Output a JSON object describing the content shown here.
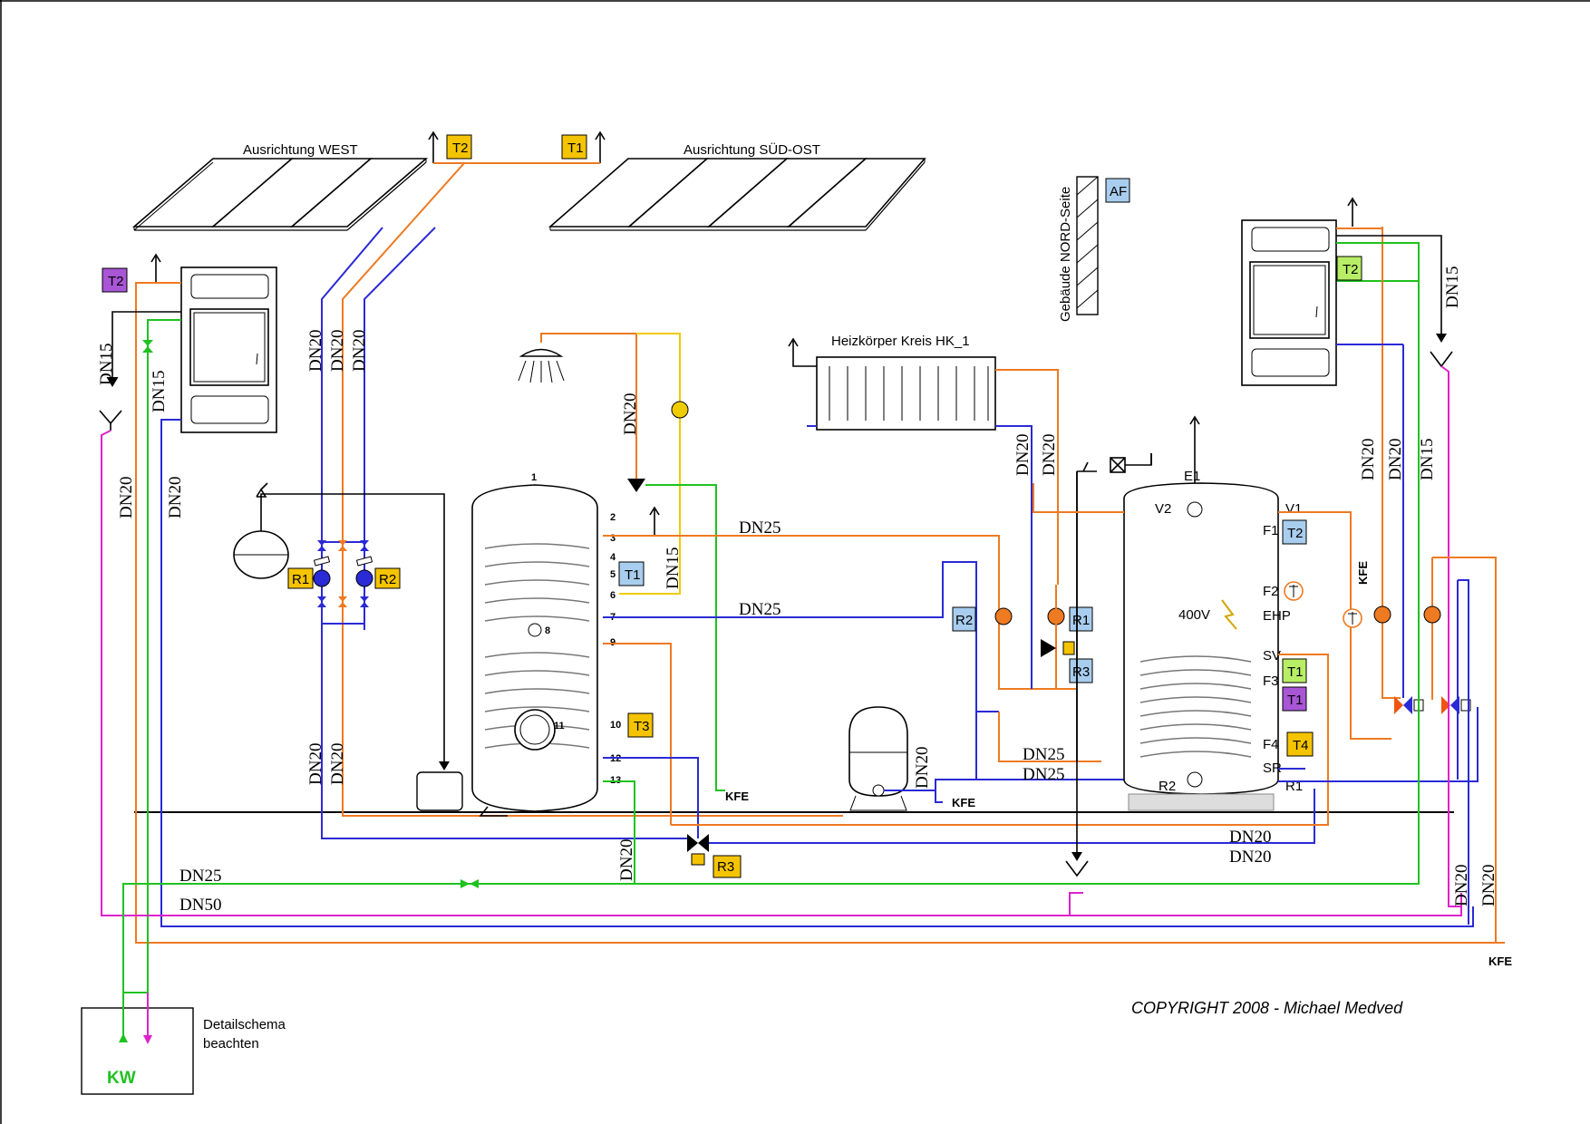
{
  "colors": {
    "flow": "#ee7a22",
    "return": "#2a2ad6",
    "cold_water": "#1fc21f",
    "drain": "#dd22cc",
    "hot_water_circ": "#eecc00",
    "tag_orange": "#f5c400",
    "tag_blue": "#a8cdee",
    "tag_purple": "#a855d6",
    "tag_green": "#b8ee66"
  },
  "titles": {
    "collector_west": "Ausrichtung WEST",
    "collector_southeast": "Ausrichtung SÜD-OST",
    "radiator": "Heizkörper Kreis HK_1",
    "building_north": "Gebäude NORD-Seite",
    "detail_note_line1": "Detailschema",
    "detail_note_line2": "beachten",
    "cold_water": "KW",
    "voltage": "400V",
    "copyright": "COPYRIGHT 2008 - Michael Medved"
  },
  "tags": {
    "t2_collector": "T2",
    "t1_collector": "T1",
    "af": "AF",
    "t2_left_boiler": "T2",
    "t2_right_boiler": "T2",
    "r1_left": "R1",
    "r2_left": "R2",
    "t1_tank": "T1",
    "t3_tank": "T3",
    "r3_bottom": "R3",
    "r2_mid": "R2",
    "r1_mid": "R1",
    "r3_mid": "R3",
    "t2_buffer": "T2",
    "t1_buffer_green": "T1",
    "t1_buffer_purple": "T1",
    "t4_buffer": "T4"
  },
  "dn": {
    "dn15": "DN15",
    "dn20": "DN20",
    "dn25": "DN25",
    "dn50": "DN50"
  },
  "kfe": "KFE",
  "tank_ports": [
    "1",
    "2",
    "3",
    "4",
    "5",
    "6",
    "7",
    "8",
    "9",
    "10",
    "11",
    "12",
    "13"
  ],
  "buffer_ports": {
    "e1": "E1",
    "v2": "V2",
    "v1": "V1",
    "f1": "F1",
    "f2": "F2",
    "ehp": "EHP",
    "sv": "SV",
    "f3": "F3",
    "f4": "F4",
    "sr": "SR",
    "r2": "R2",
    "r1": "R1"
  }
}
